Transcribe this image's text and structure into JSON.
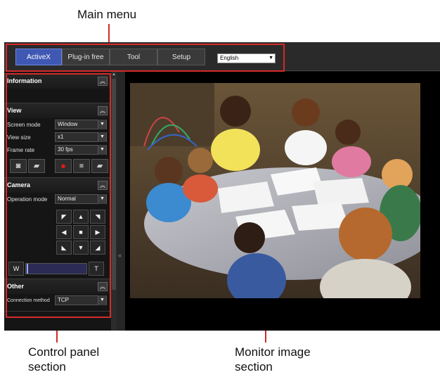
{
  "callouts": {
    "main_menu": "Main menu",
    "control_panel_line1": "Control panel",
    "control_panel_line2": "section",
    "monitor_line1": "Monitor image",
    "monitor_line2": "section"
  },
  "menu": {
    "items": [
      "ActiveX",
      "Plug-in free",
      "Tool",
      "Setup"
    ],
    "active_index": 0,
    "language": "English"
  },
  "panel": {
    "information": {
      "title": "Information"
    },
    "view": {
      "title": "View",
      "screen_mode_label": "Screen mode",
      "screen_mode_value": "Window",
      "view_size_label": "View size",
      "view_size_value": "x1",
      "frame_rate_label": "Frame rate",
      "frame_rate_value": "30 fps",
      "buttons": [
        "camera-capture-icon",
        "folder-icon",
        "record-icon",
        "stop-icon",
        "folder-icon"
      ]
    },
    "camera": {
      "title": "Camera",
      "operation_mode_label": "Operation mode",
      "operation_mode_value": "Normal",
      "zoom_wide": "W",
      "zoom_tele": "T"
    },
    "other": {
      "title": "Other",
      "connection_label": "Connection method",
      "connection_value": "TCP"
    }
  },
  "colors": {
    "annotation_red": "#d42a2a",
    "active_tab": "#3e58b4",
    "record_red": "#e01818"
  }
}
